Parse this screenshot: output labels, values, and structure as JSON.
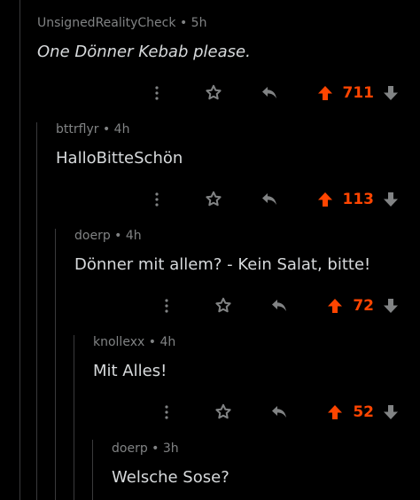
{
  "colors": {
    "background": "#000000",
    "text": "#d7dadc",
    "meta": "#818384",
    "icon": "#818384",
    "upvote_active": "#ff4500",
    "thread_line": "#3a3a3c"
  },
  "comments": [
    {
      "author": "UnsignedRealityCheck",
      "time": "5h",
      "body": "One Dönner Kebab please.",
      "score": "711",
      "more_icon": "more-vertical-icon",
      "award_icon": "award-icon",
      "reply_icon": "reply-icon",
      "upvote_icon": "upvote-arrow-icon",
      "downvote_icon": "downvote-arrow-icon"
    },
    {
      "author": "bttrflyr",
      "time": "4h",
      "body": "HalloBitteSchön",
      "score": "113"
    },
    {
      "author": "doerp",
      "time": "4h",
      "body": "Dönner mit allem? - Kein Salat, bitte!",
      "score": "72"
    },
    {
      "author": "knollexx",
      "time": "4h",
      "body": "Mit Alles!",
      "score": "52"
    },
    {
      "author": "doerp",
      "time": "3h",
      "body": "Welsche Sose?"
    }
  ]
}
